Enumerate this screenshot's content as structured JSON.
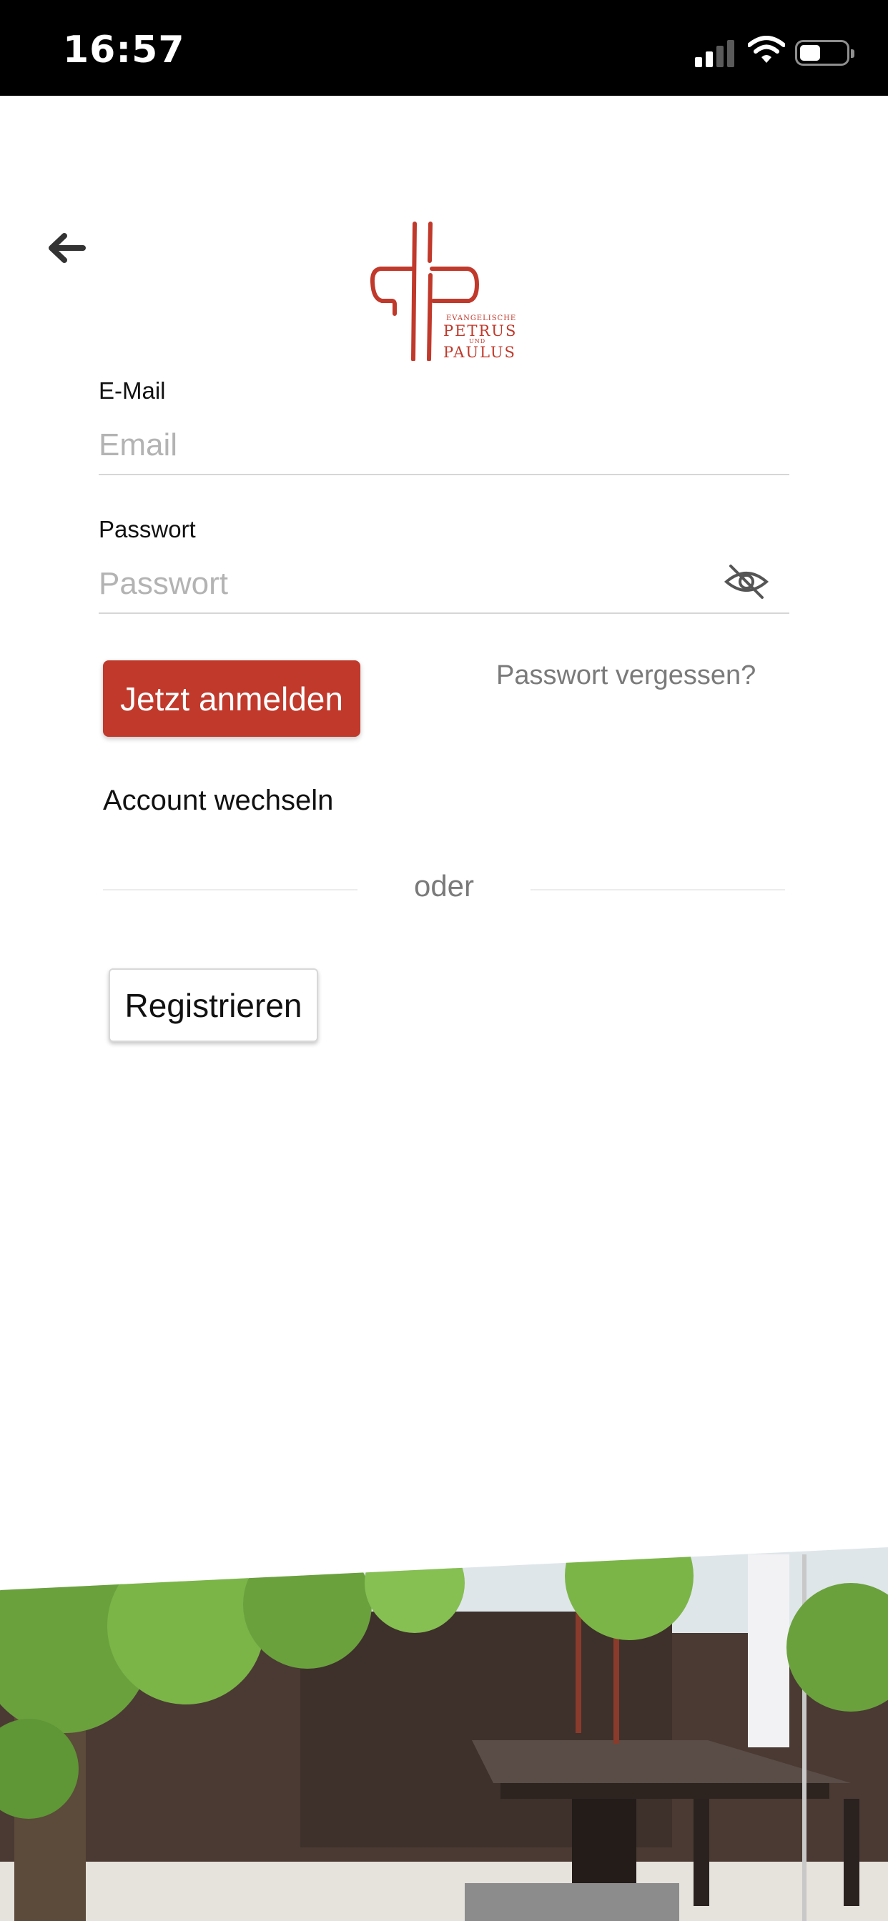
{
  "status_bar": {
    "time": "16:57"
  },
  "logo": {
    "line1": "EVANGELISCHE",
    "line2": "PETRUS",
    "line3": "UND",
    "line4": "PAULUS"
  },
  "form": {
    "email_label": "E-Mail",
    "email_placeholder": "Email",
    "email_value": "",
    "password_label": "Passwort",
    "password_placeholder": "Passwort",
    "password_value": ""
  },
  "actions": {
    "login_button": "Jetzt anmelden",
    "forgot_password": "Passwort vergessen?",
    "switch_account": "Account wechseln",
    "divider": "oder",
    "register_button": "Registrieren"
  },
  "colors": {
    "accent": "#c0392b"
  },
  "icons": {
    "back": "arrow-left-icon",
    "password_toggle": "eye-slash-icon",
    "signal": "cellular-signal-icon",
    "wifi": "wifi-icon",
    "battery": "battery-icon"
  }
}
